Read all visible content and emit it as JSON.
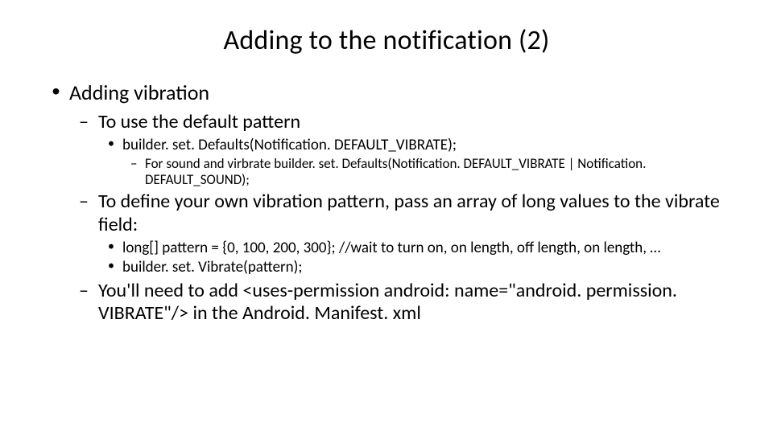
{
  "title": "Adding to the notification (2)",
  "bullets": {
    "l1_0": "Adding vibration",
    "l2_0": "To use the default pattern",
    "l3_0": "builder. set. Defaults(Notification. DEFAULT_VIBRATE);",
    "l4_0": "For sound and virbrate  builder. set. Defaults(Notification. DEFAULT_VIBRATE | Notification. DEFAULT_SOUND);",
    "l2_1": "To define your own vibration pattern, pass an array of long values to the vibrate field:",
    "l3_1": "long[] pattern = {0, 100, 200, 300}; //wait to turn on, on length, off length, on length, …",
    "l3_2": "builder. set. Vibrate(pattern);",
    "l2_2": "You'll need to add <uses-permission android: name=\"android. permission. VIBRATE\"/> in the Android. Manifest. xml"
  }
}
